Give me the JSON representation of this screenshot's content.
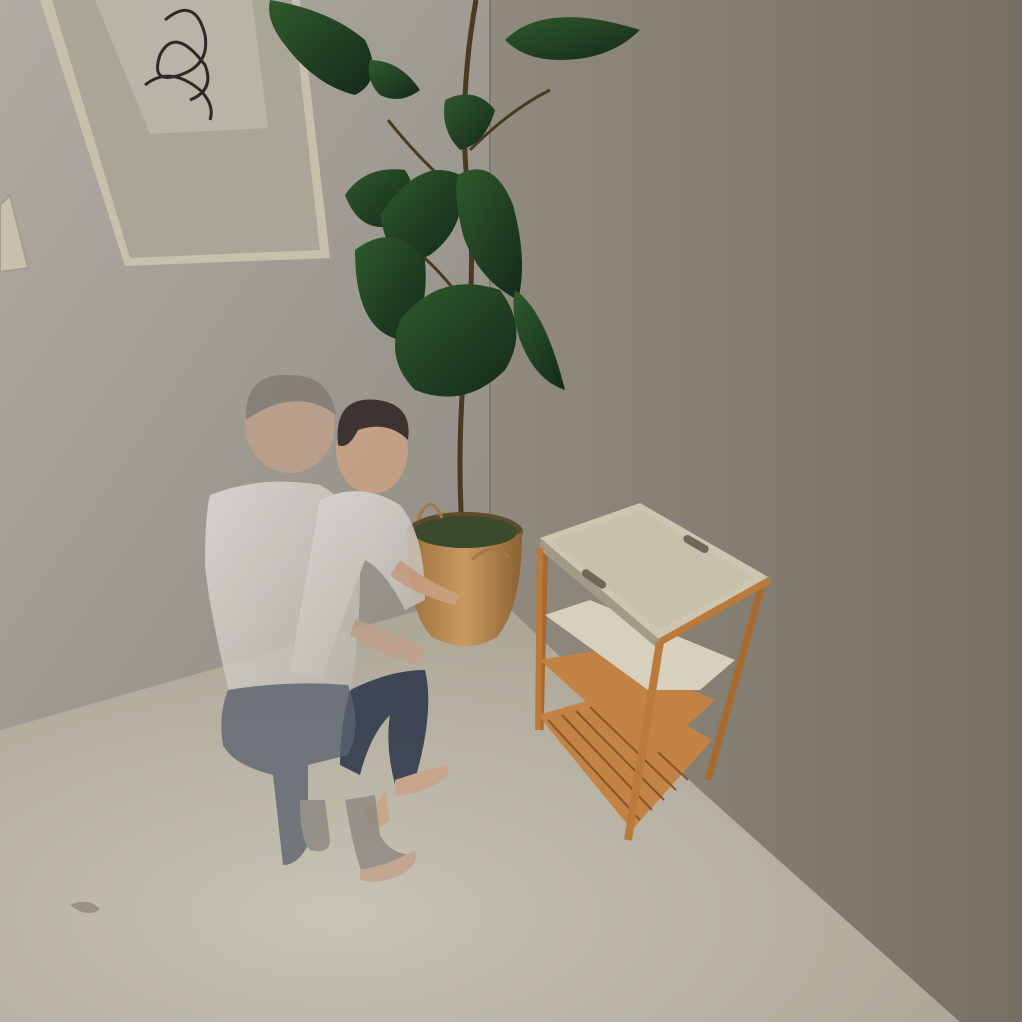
{
  "scene": {
    "kind": "3d-rendered-interior",
    "objects": [
      "wall-art-left",
      "wall-art-partial",
      "fiddle-leaf-fig-plant",
      "woven-basket-pot",
      "bamboo-serving-cart",
      "person-standing-male",
      "person-standing-female"
    ]
  },
  "palette": {
    "left_wall": "#a29e95",
    "right_wall": "#8a8478",
    "floor": "#bdb8a8",
    "wood": "#b97a3c",
    "leaf": "#1f3a1f",
    "shirt": "#d9d7d2",
    "jeans": "#2a3347"
  }
}
